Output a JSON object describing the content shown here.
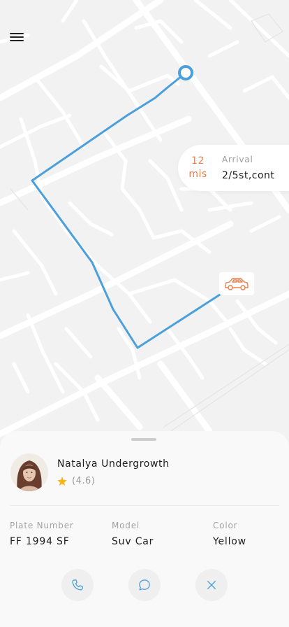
{
  "colors": {
    "route": "#4b9fdb",
    "accent": "#e4804f",
    "road": "#ffffff",
    "map_bg": "#f2f2f2"
  },
  "icons": {
    "menu": "menu-icon",
    "car": "car-icon",
    "star": "star-icon",
    "phone": "phone-icon",
    "message": "message-icon",
    "close": "close-icon"
  },
  "eta": {
    "minutes": "12",
    "unit": "mis",
    "label": "Arrival",
    "address": "2/5st,cont"
  },
  "driver": {
    "name": "Natalya Undergrowth",
    "rating": "(4.6)"
  },
  "vehicle": {
    "plate_label": "Plate Number",
    "plate_value": "FF 1994 SF",
    "model_label": "Model",
    "model_value": "Suv Car",
    "color_label": "Color",
    "color_value": "Yellow"
  }
}
